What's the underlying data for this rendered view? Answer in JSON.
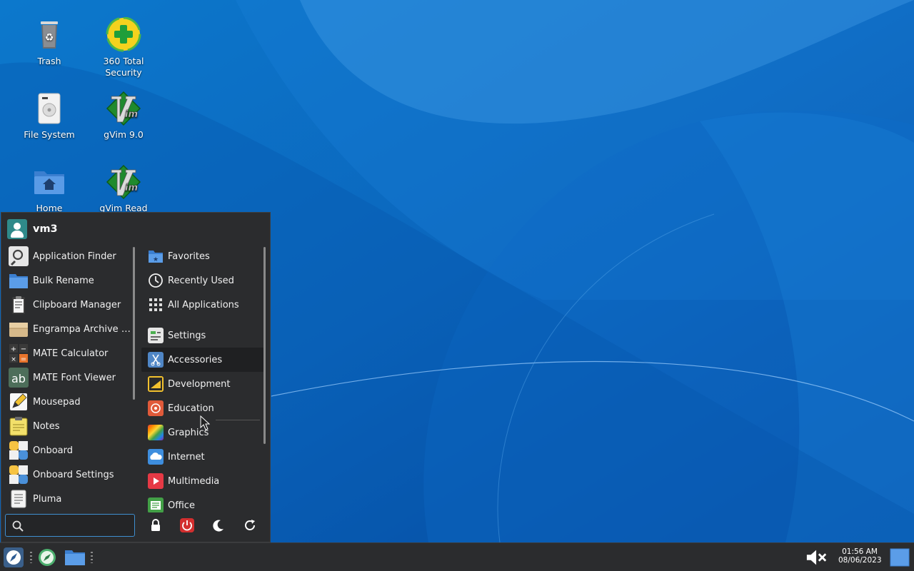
{
  "desktop": {
    "icons": [
      {
        "label": "Trash",
        "icon": "trash-icon"
      },
      {
        "label": "360 Total Security",
        "icon": "security-plus-icon"
      },
      {
        "label": "File System",
        "icon": "drive-icon"
      },
      {
        "label": "gVim 9.0",
        "icon": "vim-icon"
      },
      {
        "label": "Home",
        "icon": "home-folder-icon"
      },
      {
        "label": "gVim Read",
        "icon": "vim-icon"
      }
    ]
  },
  "menu": {
    "username": "vm3",
    "apps": [
      "Application Finder",
      "Bulk Rename",
      "Clipboard Manager",
      "Engrampa Archive M…",
      "MATE Calculator",
      "MATE Font Viewer",
      "Mousepad",
      "Notes",
      "Onboard",
      "Onboard Settings",
      "Pluma"
    ],
    "categories": [
      "Favorites",
      "Recently Used",
      "All Applications",
      "Settings",
      "Accessories",
      "Development",
      "Education",
      "Graphics",
      "Internet",
      "Multimedia",
      "Office"
    ],
    "highlighted_category": "Accessories",
    "search": {
      "value": "",
      "placeholder": ""
    },
    "actions": [
      "lock-icon",
      "power-icon",
      "suspend-moon-icon",
      "restart-icon"
    ]
  },
  "taskbar": {
    "clock_time": "01:56 AM",
    "clock_date": "08/06/2023",
    "volume_state": "muted"
  },
  "colors": {
    "accent": "#3f8fd0",
    "panel": "#2b2c2e",
    "desktop": "#0a5fb4"
  }
}
